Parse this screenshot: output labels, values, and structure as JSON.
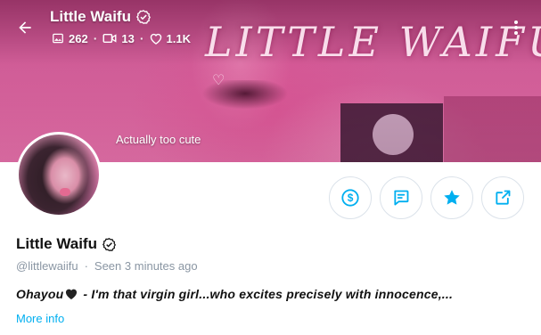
{
  "header": {
    "title": "Little Waifu",
    "stats": {
      "photos": "262",
      "videos": "13",
      "likes": "1.1K"
    }
  },
  "cover": {
    "overlay_text": "LITTLE WAIFU",
    "caption": "Actually too cute"
  },
  "profile": {
    "name": "Little Waifu",
    "handle": "@littlewaiifu",
    "seen_label": "Seen",
    "seen_time": "3 minutes ago",
    "bio_start": "Ohayou",
    "bio_rest": " - I'm that virgin girl...who excites precisely with innocence,...",
    "more_info": "More info"
  },
  "colors": {
    "accent": "#00aff0",
    "muted": "#8a96a3",
    "text": "#111111"
  },
  "icons": {
    "back": "arrow-left-icon",
    "verified": "verified-badge-icon",
    "photos": "image-icon",
    "videos": "video-icon",
    "likes": "heart-icon",
    "more": "kebab-menu-icon",
    "tip": "dollar-icon",
    "message": "message-icon",
    "favorite": "star-icon",
    "share": "share-icon"
  }
}
